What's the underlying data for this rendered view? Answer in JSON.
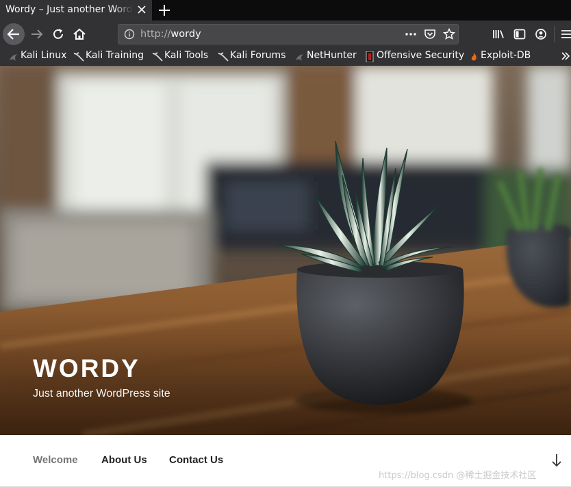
{
  "browser": {
    "tab": {
      "title": "Wordy – Just another WordPress site"
    },
    "url": {
      "protocol": "http://",
      "host": "wordy"
    },
    "bookmarks": [
      {
        "label": "Kali Linux",
        "icon": "kali-dragon-icon"
      },
      {
        "label": "Kali Training",
        "icon": "kali-dragon-icon"
      },
      {
        "label": "Kali Tools",
        "icon": "kali-dragon-icon"
      },
      {
        "label": "Kali Forums",
        "icon": "kali-dragon-icon"
      },
      {
        "label": "NetHunter",
        "icon": "kali-dragon-icon"
      },
      {
        "label": "Offensive Security",
        "icon": "offsec-icon"
      },
      {
        "label": "Exploit-DB",
        "icon": "exploitdb-icon"
      }
    ],
    "colors": {
      "tabbar": "#0c0c0d",
      "toolbar": "#323234",
      "urlbar": "#474749",
      "text": "#f9f9fa"
    }
  },
  "site": {
    "title": "WORDY",
    "description": "Just another WordPress site",
    "menu": [
      {
        "label": "Welcome",
        "current": true
      },
      {
        "label": "About Us",
        "current": false
      },
      {
        "label": "Contact Us",
        "current": false
      }
    ],
    "watermark": "https://blog.csdn @稀土掘金技术社区"
  }
}
